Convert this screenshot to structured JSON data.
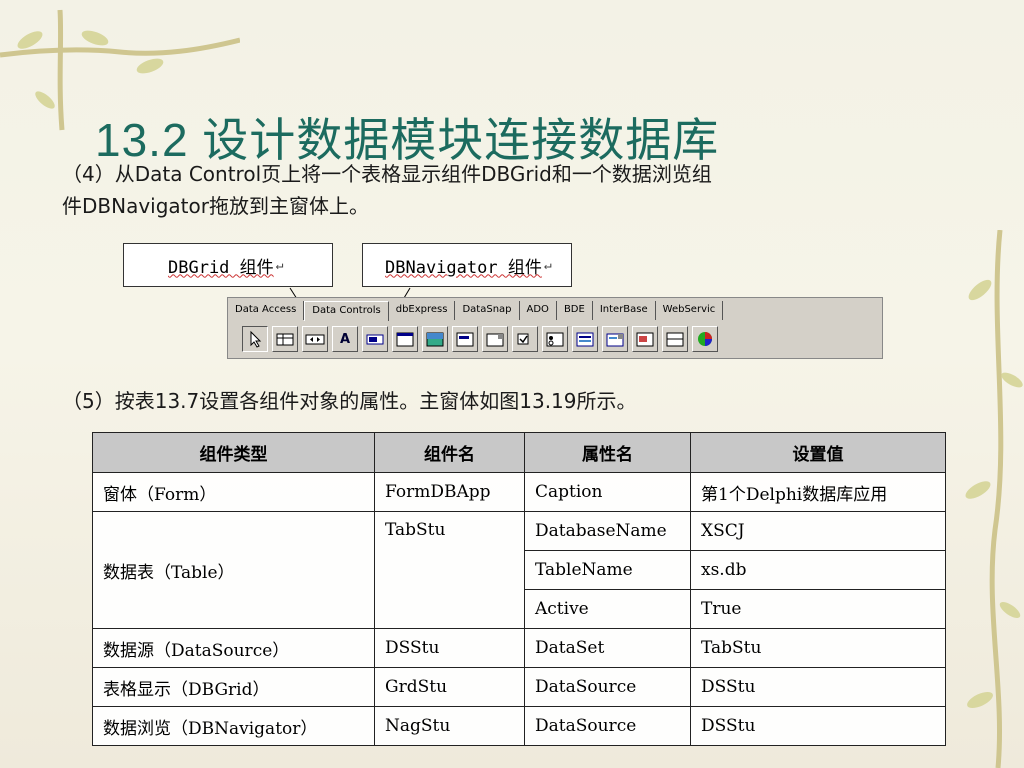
{
  "title": "13.2  设计数据模块连接数据库",
  "para4": {
    "line1": "（4）从Data Control页上将一个表格显示组件DBGrid和一个数据浏览组",
    "line2": "件DBNavigator拖放到主窗体上。"
  },
  "callouts": {
    "dbgrid": "DBGrid 组件",
    "dbnavigator": "DBNavigator 组件",
    "return_mark": "↵"
  },
  "palette": {
    "tabs": [
      "Data Access",
      "Data Controls",
      "dbExpress",
      "DataSnap",
      "ADO",
      "BDE",
      "InterBase",
      "WebServic"
    ],
    "active_tab": "Data Controls",
    "icons": [
      "pointer-icon",
      "dbgrid-icon",
      "dbnavigator-icon",
      "dbtext-icon",
      "dbedit-icon",
      "dbmemo-icon",
      "dbimage-icon",
      "dblistbox-icon",
      "dbcombobox-icon",
      "dbcheckbox-icon",
      "dbradiogroup-icon",
      "dblookuplistbox-icon",
      "dblookupcombobox-icon",
      "dbrichedit-icon",
      "dbctrlgrid-icon",
      "dbchart-icon"
    ],
    "text_icon_glyph": "A"
  },
  "para5": "（5）按表13.7设置各组件对象的属性。主窗体如图13.19所示。",
  "table": {
    "headers": [
      "组件类型",
      "组件名",
      "属性名",
      "设置值"
    ],
    "rows": {
      "form": {
        "type": "窗体（Form）",
        "name": "FormDBApp",
        "prop": "Caption",
        "value": "第1个Delphi数据库应用"
      },
      "table": {
        "type": "数据表（Table）",
        "name": "TabStu",
        "props": [
          {
            "prop": "DatabaseName",
            "value": "XSCJ"
          },
          {
            "prop": "TableName",
            "value": "xs.db"
          },
          {
            "prop": "Active",
            "value": "True"
          }
        ]
      },
      "datasource": {
        "type": "数据源（DataSource）",
        "name": "DSStu",
        "prop": "DataSet",
        "value": "TabStu"
      },
      "dbgrid": {
        "type": "表格显示（DBGrid）",
        "name": "GrdStu",
        "prop": "DataSource",
        "value": "DSStu"
      },
      "dbnav": {
        "type": "数据浏览（DBNavigator）",
        "name": "NagStu",
        "prop": "DataSource",
        "value": "DSStu"
      }
    }
  },
  "colors": {
    "title": "#1c6b5f",
    "vine": "#c9c28a",
    "leaf": "#cfd39a"
  }
}
